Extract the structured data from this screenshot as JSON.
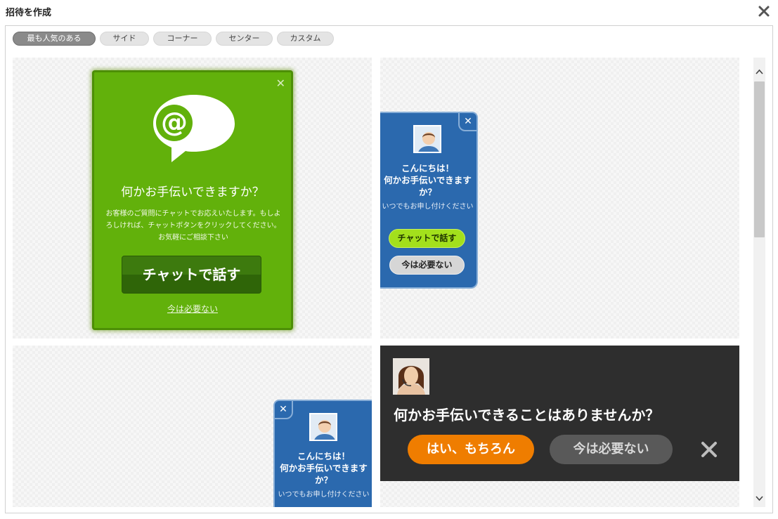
{
  "window": {
    "title": "招待を作成",
    "close_icon": "close-icon"
  },
  "tabs": [
    {
      "label": "最も人気のある",
      "active": true
    },
    {
      "label": "サイド",
      "active": false
    },
    {
      "label": "コーナー",
      "active": false
    },
    {
      "label": "センター",
      "active": false
    },
    {
      "label": "カスタム",
      "active": false
    }
  ],
  "templates": {
    "green_popup": {
      "close_glyph": "✕",
      "icon": "chat-bubble-at-icon",
      "headline": "何かお手伝いできますか？",
      "body": "お客様のご質問にチャットでお応えいたします。もしよろしければ、チャットボタンをクリックしてください。お気軽にご相談下さい",
      "button": "チャットで話す",
      "decline": "今は必要ない",
      "color": "#62b10b"
    },
    "blue_side": {
      "close_glyph": "✕",
      "greeting": "こんにちは！",
      "headline": "何かお手伝いできますか？",
      "sub": "いつでもお申し付けください",
      "button_chat": "チャットで話す",
      "button_decline": "今は必要ない",
      "color": "#2b69ae"
    },
    "blue_corner": {
      "close_glyph": "✕",
      "greeting": "こんにちは！",
      "headline": "何かお手伝いできますか？",
      "sub": "いつでもお申し付けください"
    },
    "dark_bar": {
      "headline": "何かお手伝いできることはありませんか？",
      "button_yes": "はい、もちろん",
      "button_no": "今は必要ない",
      "accent": "#ef7d00",
      "background": "#2e2e2e"
    }
  }
}
